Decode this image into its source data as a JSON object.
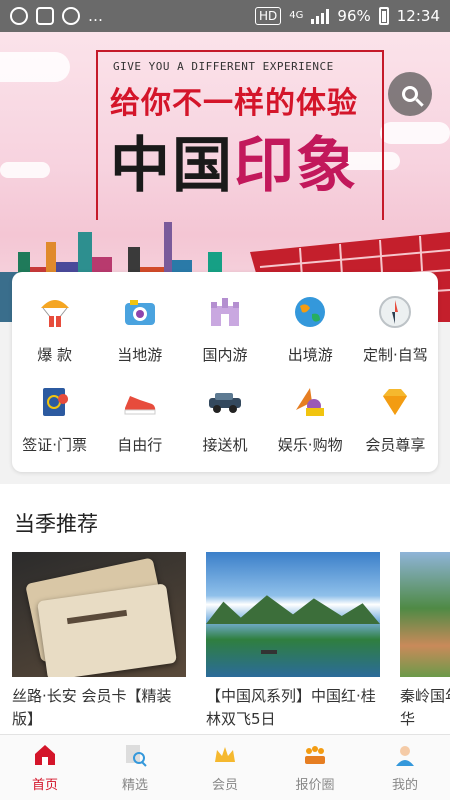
{
  "status_bar": {
    "network": "HD",
    "network_type": "4G",
    "battery": "96%",
    "time": "12:34"
  },
  "banner": {
    "tagline_en": "GIVE YOU A DIFFERENT EXPERIENCE",
    "tagline_cn": "给你不一样的体验",
    "title_cn": "中国印象",
    "search_icon": "search-icon"
  },
  "categories": [
    {
      "label": "爆 款",
      "icon": "parachute-gift-icon"
    },
    {
      "label": "当地游",
      "icon": "camera-icon"
    },
    {
      "label": "国内游",
      "icon": "castle-icon"
    },
    {
      "label": "出境游",
      "icon": "globe-icon"
    },
    {
      "label": "定制·自驾",
      "icon": "compass-icon"
    },
    {
      "label": "签证·门票",
      "icon": "passport-icon"
    },
    {
      "label": "自由行",
      "icon": "sneaker-icon"
    },
    {
      "label": "接送机",
      "icon": "car-icon"
    },
    {
      "label": "娱乐·购物",
      "icon": "shopping-icon"
    },
    {
      "label": "会员尊享",
      "icon": "diamond-icon"
    }
  ],
  "recommend": {
    "title": "当季推荐",
    "items": [
      {
        "title": "丝路·长安 会员卡【精装版】"
      },
      {
        "title": "【中国风系列】中国红·桂林双飞5日"
      },
      {
        "title": "秦岭国年华"
      }
    ]
  },
  "bottom_nav": [
    {
      "label": "首页",
      "icon": "home-icon",
      "active": true
    },
    {
      "label": "精选",
      "icon": "document-search-icon",
      "active": false
    },
    {
      "label": "会员",
      "icon": "crown-icon",
      "active": false
    },
    {
      "label": "报价圈",
      "icon": "group-icon",
      "active": false
    },
    {
      "label": "我的",
      "icon": "user-icon",
      "active": false
    }
  ]
}
